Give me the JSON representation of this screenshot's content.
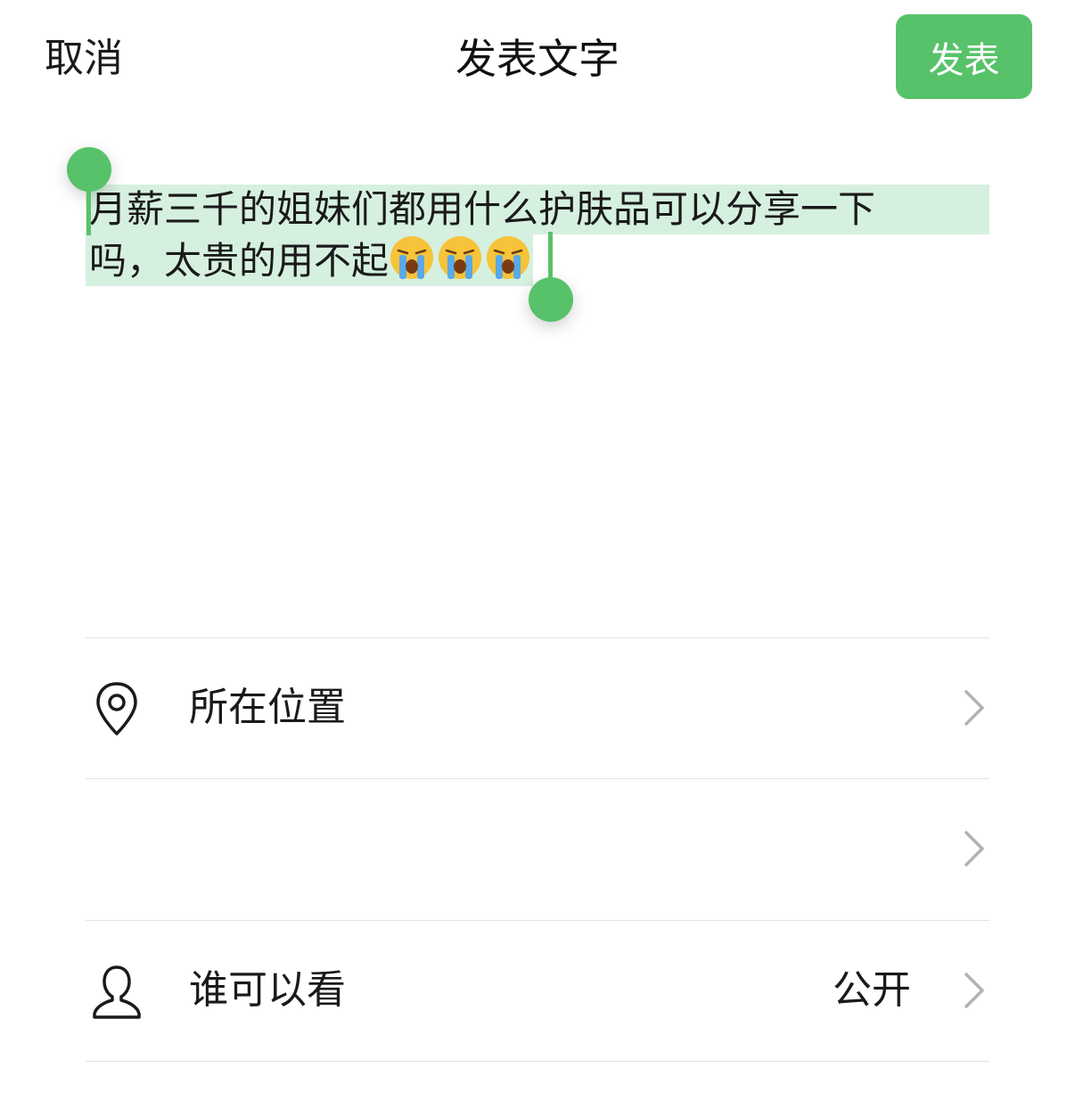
{
  "header": {
    "cancel_label": "取消",
    "title": "发表文字",
    "publish_label": "发表"
  },
  "editor": {
    "line1": "月薪三千的姐妹们都用什么护肤品可以分享一下",
    "line2": "吗，太贵的用不起",
    "emoji_count": 3,
    "emoji_name": "loudly-crying-face",
    "selection_color": "#d6f0df",
    "handle_color": "#58c26a"
  },
  "rows": {
    "location": {
      "label": "所在位置",
      "icon": "location-pin-icon"
    },
    "empty_row": {
      "label": ""
    },
    "visibility": {
      "label": "谁可以看",
      "value": "公开",
      "icon": "person-icon"
    }
  },
  "colors": {
    "accent": "#58c26a",
    "divider": "#e3e3e3",
    "chevron": "#b2b2b2"
  }
}
